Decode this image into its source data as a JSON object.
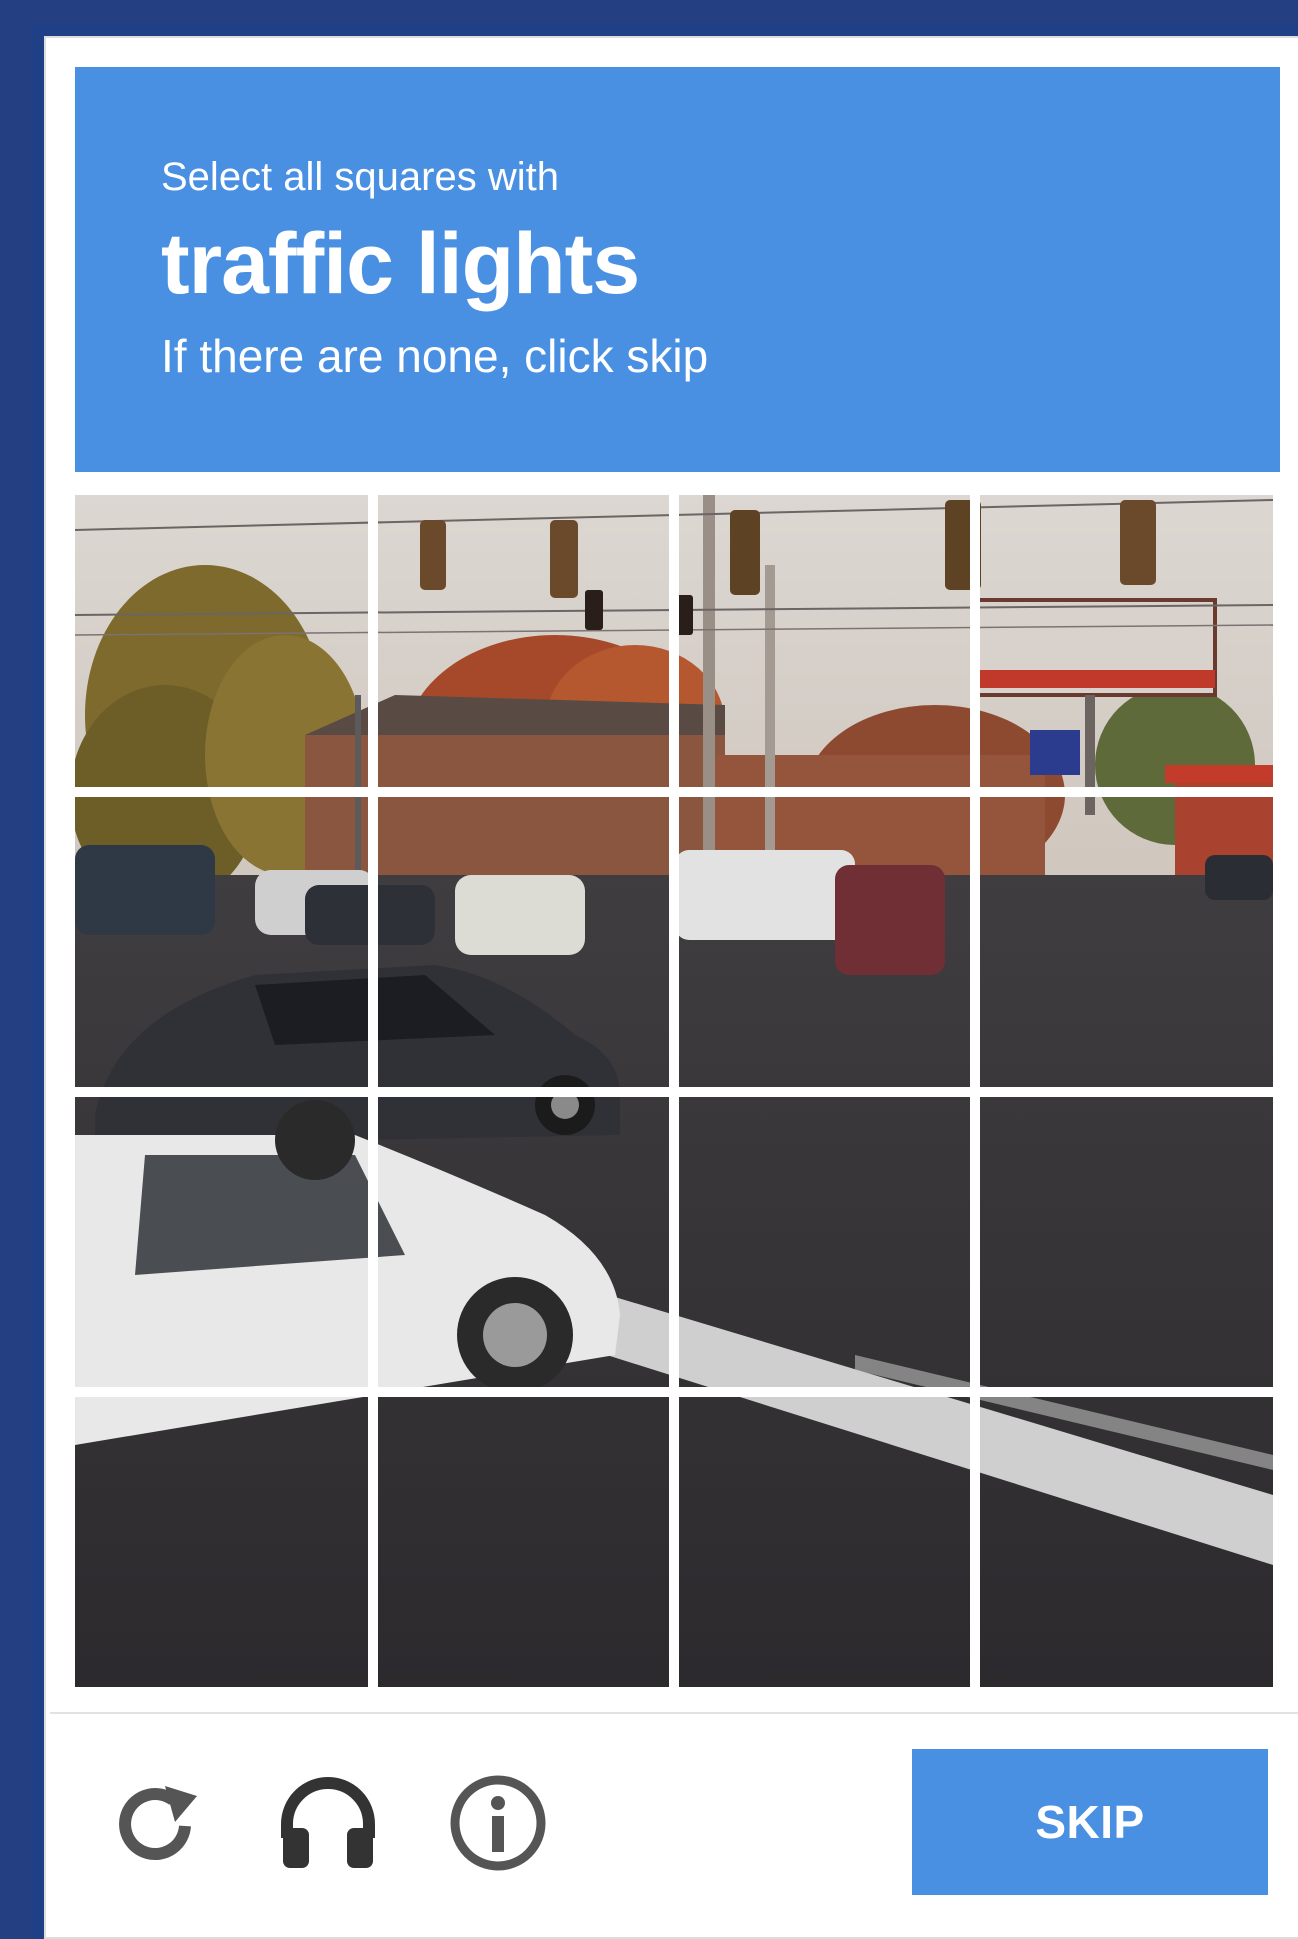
{
  "header": {
    "instruction": "Select all squares with",
    "target": "traffic lights",
    "hint": "If there are none, click skip"
  },
  "grid": {
    "rows": 4,
    "cols": 4
  },
  "footer": {
    "reload_icon": "reload-icon",
    "audio_icon": "headphones-icon",
    "info_icon": "info-icon",
    "skip_label": "SKIP"
  },
  "colors": {
    "accent": "#4a90e2",
    "frame": "#243f82",
    "icon": "#555555"
  }
}
